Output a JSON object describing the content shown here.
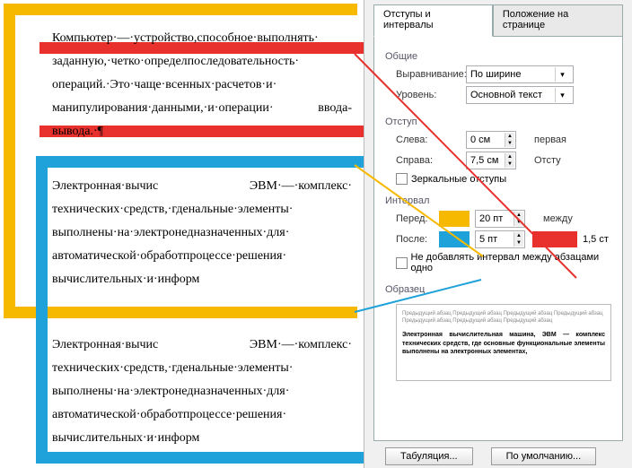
{
  "paragraphs": {
    "p1": "Компьютер·—·устройство,способное·выполнять· заданную,·четко·определпоследовательность· операций.·Это·чаще·всенных·расчетов·и· манипулирования·данными,·и·операции· ввода-вывода.·¶",
    "p2": "Электронная·вычис ЭВМ·—·комплекс· технических·средств,·гденальные·элементы· выполнены·на·электронедназначенных·для· автоматической·обработпроцессе·решения· вычислительных·и·информ",
    "p3": "Электронная·вычис ЭВМ·—·комплекс· технических·средств,·гденальные·элементы· выполнены·на·электронедназначенных·для· автоматической·обработпроцессе·решения· вычислительных·и·информ"
  },
  "panel": {
    "tabs": {
      "active": "Отступы и интервалы",
      "other": "Положение на странице"
    },
    "common": {
      "title": "Общие",
      "align_label": "Выравнивание:",
      "align_value": "По ширине",
      "level_label": "Уровень:",
      "level_value": "Основной текст"
    },
    "indent": {
      "title": "Отступ",
      "left_label": "Слева:",
      "left_value": "0 см",
      "right_label": "Справа:",
      "right_value": "7,5 см",
      "first_label": "первая",
      "by_label": "Отсту",
      "mirror": "Зеркальные отступы"
    },
    "interval": {
      "title": "Интервал",
      "before_label": "Перед:",
      "before_value": "20 пт",
      "after_label": "После:",
      "after_value": "5 пт",
      "linesp_label": "между",
      "linesp_value": "1,5 ст",
      "nospace": "Не добавлять интервал между абзацами одно"
    },
    "sample": {
      "title": "Образец",
      "gray1": "Предыдущий абзац Предыдущий абзац Предыдущий абзац Предыдущий абзац Предыдущий абзац Предыдущий абзац Предыдущий абзац",
      "bold": "Электронная вычислительная машина, ЭВМ — комплекс технических средств, где основные функциональные элементы выполнены на электронных элементах,",
      "gray2": ""
    },
    "buttons": {
      "tabs": "Табуляция...",
      "default": "По умолчанию..."
    }
  }
}
